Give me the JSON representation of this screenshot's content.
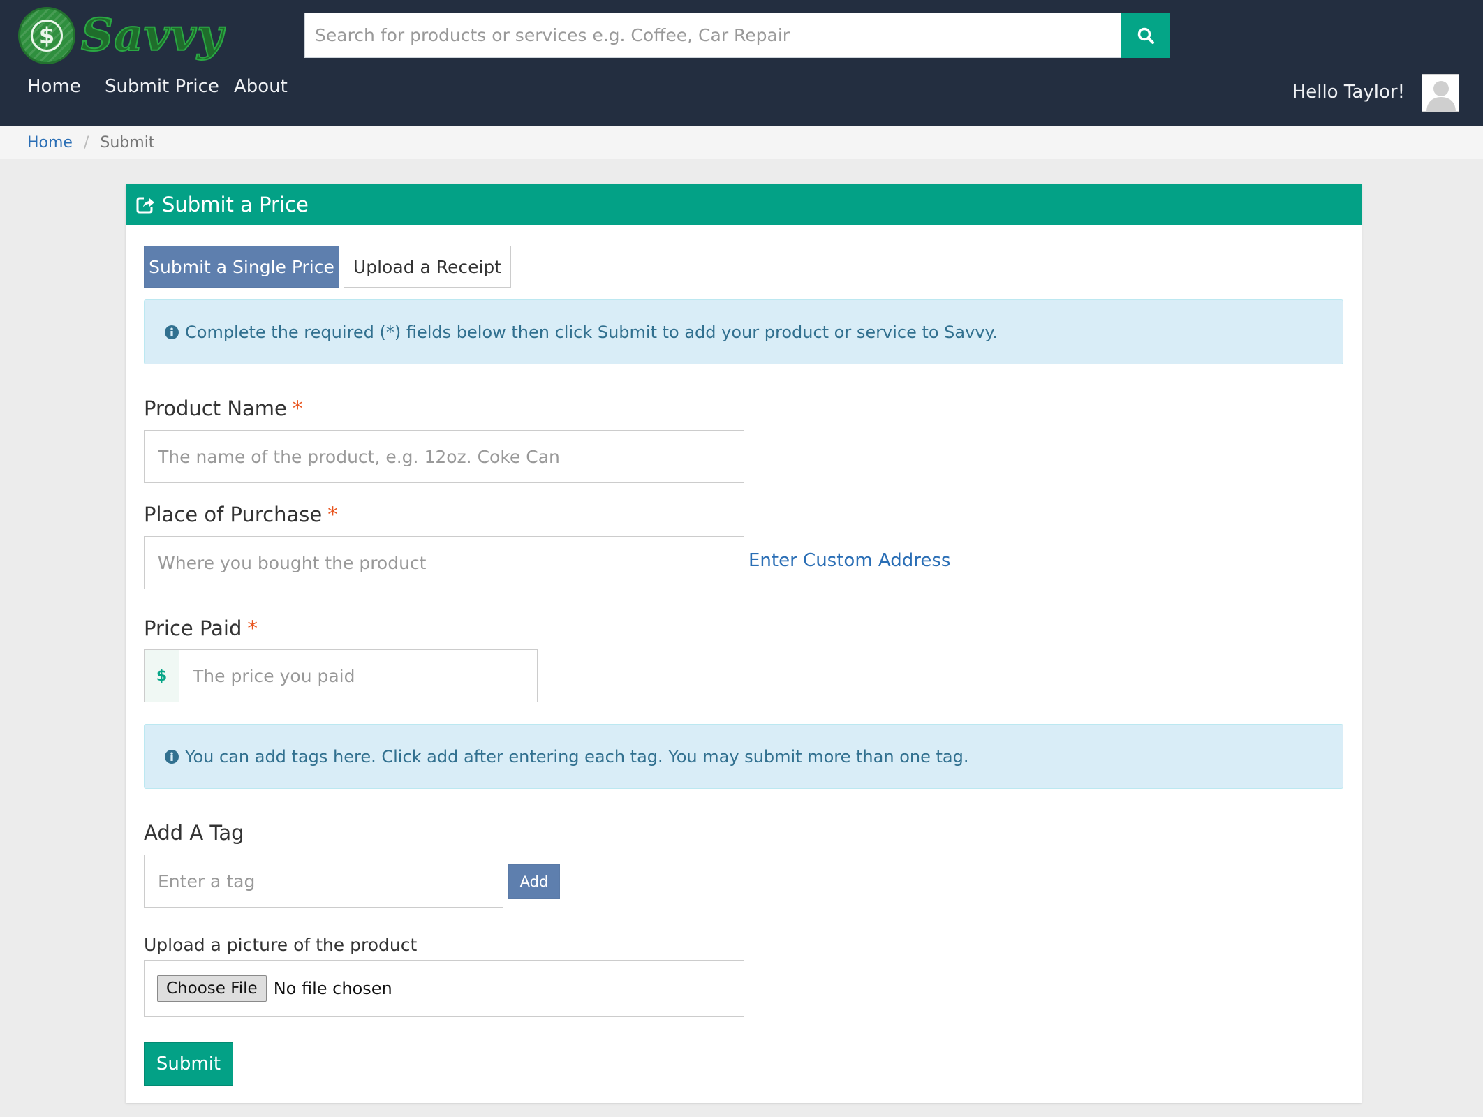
{
  "brand": {
    "name": "Savvy",
    "logo_symbol": "$"
  },
  "search": {
    "placeholder": "Search for products or services e.g. Coffee, Car Repair",
    "value": ""
  },
  "nav": {
    "items": [
      {
        "label": "Home"
      },
      {
        "label": "Submit Price"
      },
      {
        "label": "About"
      }
    ],
    "greeting": "Hello Taylor!"
  },
  "breadcrumb": {
    "home": "Home",
    "separator": "/",
    "current": "Submit"
  },
  "card": {
    "title": "Submit a Price",
    "tabs": {
      "active": "Submit a Single Price",
      "inactive": "Upload a Receipt"
    },
    "info_required": "Complete the required (*) fields below then click Submit to add your product or service to Savvy.",
    "product_name": {
      "label": "Product Name",
      "required_mark": "*",
      "placeholder": "The name of the product, e.g. 12oz. Coke Can",
      "value": ""
    },
    "place": {
      "label": "Place of Purchase",
      "required_mark": "*",
      "placeholder": "Where you bought the product",
      "value": "",
      "custom_link": "Enter Custom Address"
    },
    "price": {
      "label": "Price Paid",
      "required_mark": "*",
      "currency": "$",
      "placeholder": "The price you paid",
      "value": ""
    },
    "info_tags": "You can add tags here. Click add after entering each tag. You may submit more than one tag.",
    "tag": {
      "label": "Add A Tag",
      "placeholder": "Enter a tag",
      "value": "",
      "add_label": "Add"
    },
    "upload": {
      "label": "Upload a picture of the product",
      "button": "Choose File",
      "status": "No file chosen"
    },
    "submit_label": "Submit"
  },
  "colors": {
    "navbar": "#232e40",
    "accent_green": "#03a186",
    "tab_blue": "#5e7fae",
    "link_blue": "#2a6eb5",
    "required_orange": "#e8541e",
    "info_bg": "#d9edf7",
    "info_text": "#31708f"
  },
  "icons": {
    "search": "search-icon",
    "card_header": "share-square-icon",
    "info": "info-circle-icon",
    "avatar": "user-placeholder-icon"
  }
}
